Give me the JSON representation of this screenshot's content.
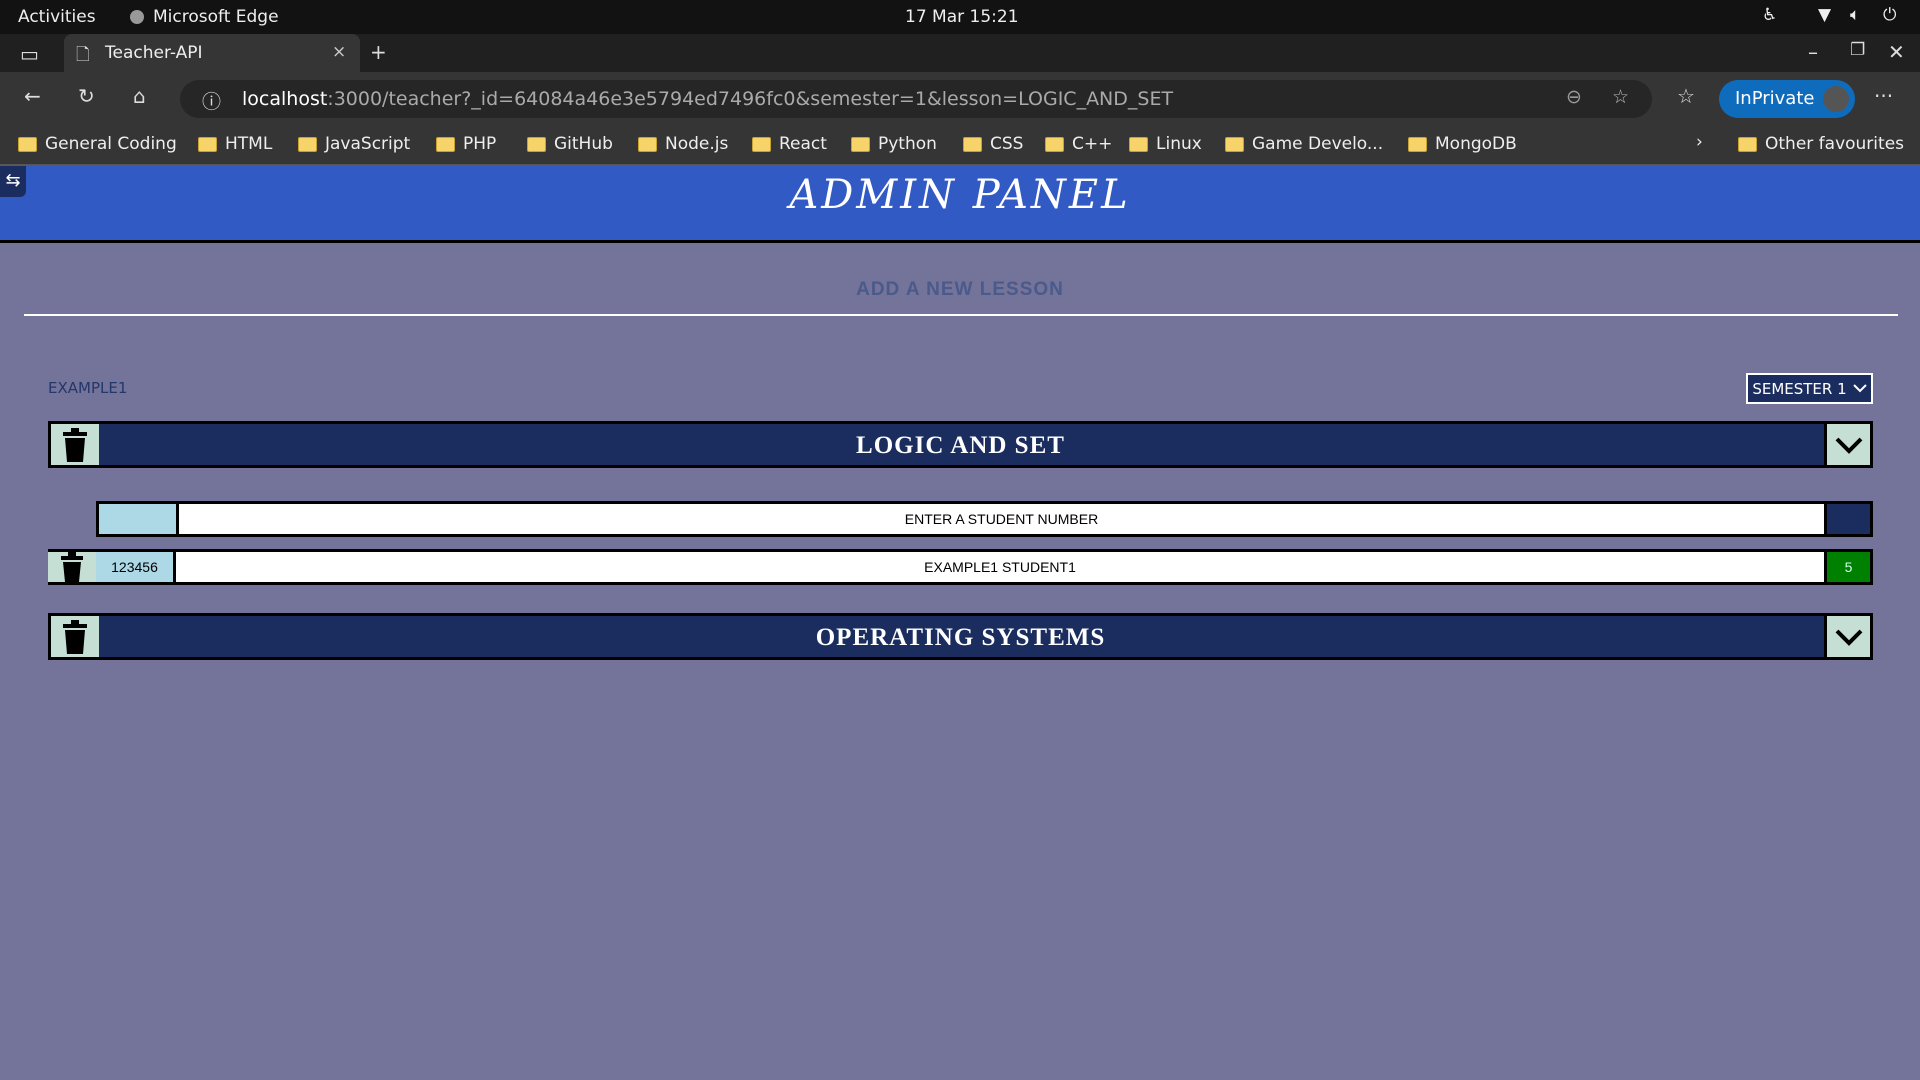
{
  "os": {
    "activities": "Activities",
    "app": "Microsoft Edge",
    "datetime": "17 Mar  15:21"
  },
  "browser": {
    "tab_title": "Teacher-API",
    "url_host": "localhost",
    "url_rest": ":3000/teacher?_id=64084a46e3e5794ed7496fc0&semester=1&lesson=LOGIC_AND_SET",
    "inprivate": "InPrivate",
    "bookmarks": [
      "General Coding",
      "HTML",
      "JavaScript",
      "PHP",
      "GitHub",
      "Node.js",
      "React",
      "Python",
      "CSS",
      "C++",
      "Linux",
      "Game Develo...",
      "MongoDB"
    ],
    "other_favourites": "Other favourites"
  },
  "page": {
    "title": "ADMIN PANEL",
    "add_lesson": "ADD A NEW LESSON",
    "teacher_name": "EXAMPLE1",
    "semester": "SEMESTER 1",
    "lessons": [
      {
        "name": "LOGIC AND SET"
      },
      {
        "name": "OPERATING SYSTEMS"
      }
    ],
    "student_input": {
      "number_value": "",
      "name_placeholder": "ENTER A STUDENT NUMBER"
    },
    "students": [
      {
        "number": "123456",
        "name": "EXAMPLE1 STUDENT1",
        "grade": "5"
      }
    ]
  },
  "colors": {
    "header": "#325ac4",
    "navy": "#1a2d5e",
    "background": "#74739a",
    "grade_pass": "#008000"
  }
}
